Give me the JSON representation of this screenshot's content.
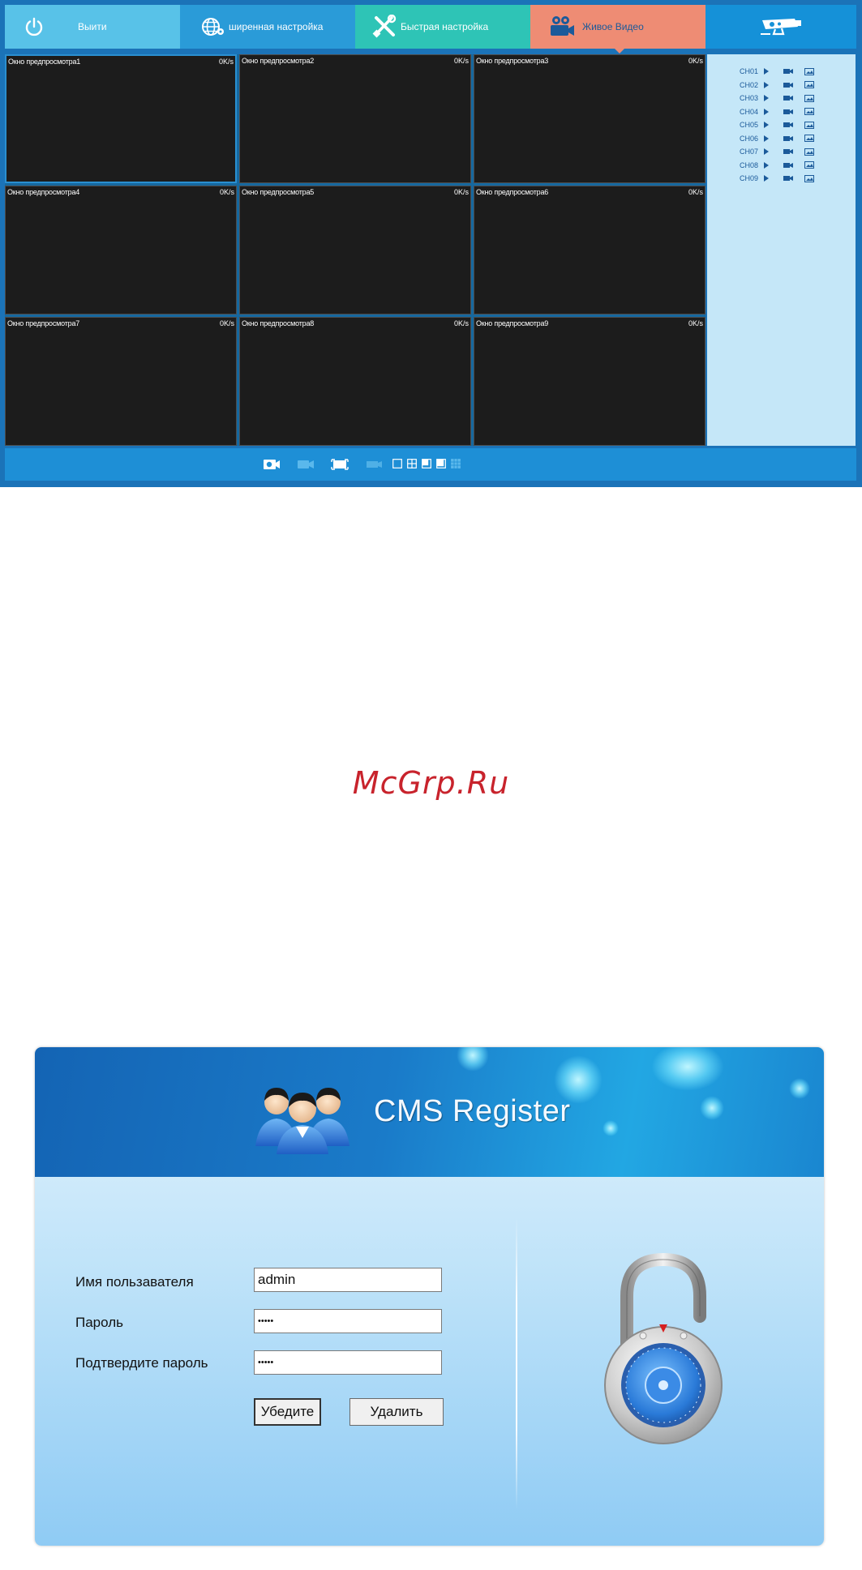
{
  "topnav": {
    "exit_label": "Выити",
    "advanced_label": "ширенная настройка",
    "quick_label": "Быстрая настройка",
    "live_label": "Живое Видео"
  },
  "preview": {
    "windows": [
      {
        "title": "Окно предпросмотра1",
        "rate": "0K/s",
        "selected": true
      },
      {
        "title": "Окно предпросмотра2",
        "rate": "0K/s"
      },
      {
        "title": "Окно предпросмотра3",
        "rate": "0K/s"
      },
      {
        "title": "Окно предпросмотра4",
        "rate": "0K/s"
      },
      {
        "title": "Окно предпросмотра5",
        "rate": "0K/s"
      },
      {
        "title": "Окно предпросмотра6",
        "rate": "0K/s"
      },
      {
        "title": "Окно предпросмотра7",
        "rate": "0K/s"
      },
      {
        "title": "Окно предпросмотра8",
        "rate": "0K/s"
      },
      {
        "title": "Окно предпросмотра9",
        "rate": "0K/s"
      }
    ]
  },
  "channels": [
    "CH01",
    "CH02",
    "CH03",
    "CH04",
    "CH05",
    "CH06",
    "CH07",
    "CH08",
    "CH09"
  ],
  "toolbar": {
    "icons": [
      "snapshot-icon",
      "record-icon",
      "fullscreen-icon",
      "stream-icon",
      "layout-1-icon",
      "layout-4-icon",
      "layout-6-icon",
      "layout-8-icon",
      "layout-9-icon"
    ]
  },
  "watermark": "McGrp.Ru",
  "register": {
    "title": "CMS Register",
    "username_label": "Имя пользавателя",
    "username_value": "admin",
    "password_label": "Пароль",
    "password_value": "•••••",
    "confirm_label": "Подтвердите пароль",
    "confirm_value": "•••••",
    "confirm_button": "Убедите",
    "delete_button": "Удалить"
  },
  "colors": {
    "frame_blue": "#1b73b8",
    "tab_exit": "#58c2e8",
    "tab_advanced": "#2a9bd8",
    "tab_quick": "#2ec4b6",
    "tab_live": "#ee8c74",
    "preview_bg": "#1c1c1c",
    "channel_panel": "#c5e7f8",
    "watermark": "#c8232c"
  }
}
